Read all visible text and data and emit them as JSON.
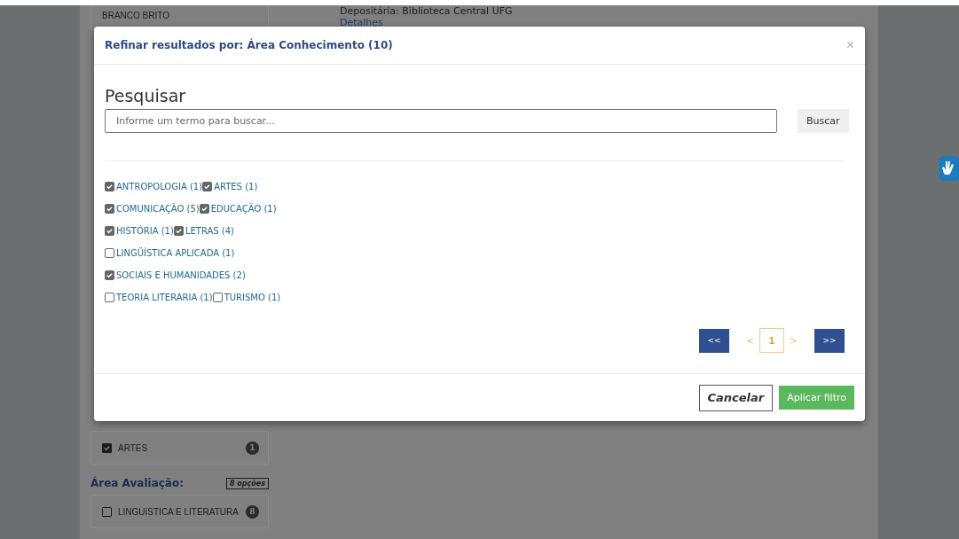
{
  "background": {
    "author": "BRANCO BRITO",
    "depositary": "Depositária: Biblioteca Central UFG",
    "details_link": "Detalhes",
    "facet_item": {
      "label": "ARTES",
      "count": "1",
      "checked": true
    },
    "facet_group": {
      "title": "Área Avaliação:",
      "options_badge": "8 opções",
      "items": [
        {
          "label": "LINGUíSTICA E LITERATURA",
          "count": "8",
          "checked": false
        }
      ]
    }
  },
  "modal": {
    "title": "Refinar resultados por: Área Conhecimento (10)",
    "close": "×",
    "search": {
      "heading": "Pesquisar",
      "placeholder": "Informe um termo para buscar...",
      "button": "Buscar"
    },
    "option_rows": [
      [
        {
          "label": "ANTROPOLOGIA (1)",
          "checked": true
        },
        {
          "label": "ARTES (1)",
          "checked": true
        }
      ],
      [
        {
          "label": "COMUNICAÇÃO (5)",
          "checked": true
        },
        {
          "label": "EDUCAÇÃO (1)",
          "checked": true
        }
      ],
      [
        {
          "label": "HISTÓRIA (1)",
          "checked": true
        },
        {
          "label": "LETRAS (4)",
          "checked": true
        }
      ],
      [
        {
          "label": "LINGÜÍSTICA APLICADA (1)",
          "checked": false
        }
      ],
      [
        {
          "label": "SOCIAIS E HUMANIDADES (2)",
          "checked": true
        }
      ],
      [
        {
          "label": "TEORIA LITERARIA (1)",
          "checked": false
        },
        {
          "label": "TURISMO (1)",
          "checked": false
        }
      ]
    ],
    "pagination": {
      "first": "<<",
      "prev": "<",
      "pages": [
        {
          "label": "1",
          "selected": true
        }
      ],
      "next": ">",
      "last": ">>"
    },
    "cancel": "Cancelar",
    "apply": "Aplicar filtro"
  }
}
